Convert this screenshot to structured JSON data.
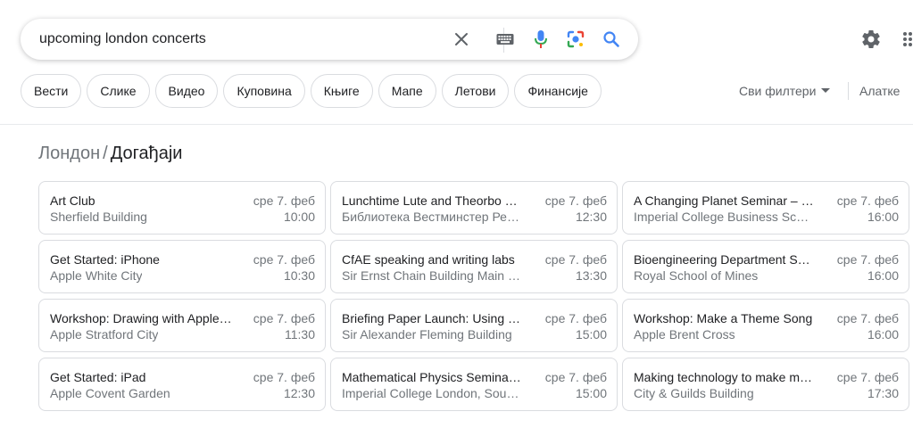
{
  "search": {
    "query": "upcoming london concerts"
  },
  "icons": {
    "clear": "close-icon",
    "keyboard": "keyboard-icon",
    "voice": "microphone-icon",
    "lens": "camera-lens-icon",
    "search": "search-icon",
    "settings": "gear-icon",
    "apps": "apps-grid-icon",
    "filters_dropdown": "caret-down-icon"
  },
  "colors": {
    "mic_blue": "#4285f4",
    "mic_red": "#ea4335",
    "search_blue": "#4285f4",
    "text": "#202124",
    "secondary_text": "#70757a"
  },
  "chips": [
    {
      "label": "Вести"
    },
    {
      "label": "Слике"
    },
    {
      "label": "Видео"
    },
    {
      "label": "Куповина"
    },
    {
      "label": "Књиге"
    },
    {
      "label": "Мапе"
    },
    {
      "label": "Летови"
    },
    {
      "label": "Финансије"
    }
  ],
  "filters": {
    "all_filters": "Сви филтери",
    "tools": "Алатке"
  },
  "breadcrumb": {
    "parent": "Лондон",
    "separator": "/",
    "current": "Догађаји"
  },
  "events": [
    {
      "title": "Art Club",
      "place": "Sherfield Building",
      "date": "сре 7. феб",
      "time": "10:00"
    },
    {
      "title": "Lunchtime Lute and Theorbo …",
      "place": "Библиотека Вестминстер Ре…",
      "date": "сре 7. феб",
      "time": "12:30"
    },
    {
      "title": "A Changing Planet Seminar – …",
      "place": "Imperial College Business Sch…",
      "date": "сре 7. феб",
      "time": "16:00"
    },
    {
      "title": "Get Started: iPhone",
      "place": "Apple White City",
      "date": "сре 7. феб",
      "time": "10:30"
    },
    {
      "title": "CfAE speaking and writing labs",
      "place": "Sir Ernst Chain Building Main …",
      "date": "сре 7. феб",
      "time": "13:30"
    },
    {
      "title": "Bioengineering Department S…",
      "place": "Royal School of Mines",
      "date": "сре 7. феб",
      "time": "16:00"
    },
    {
      "title": "Workshop: Drawing with Apple…",
      "place": "Apple Stratford City",
      "date": "сре 7. феб",
      "time": "11:30"
    },
    {
      "title": "Briefing Paper Launch: Using …",
      "place": "Sir Alexander Fleming Building",
      "date": "сре 7. феб",
      "time": "15:00"
    },
    {
      "title": "Workshop: Make a Theme Song",
      "place": "Apple Brent Cross",
      "date": "сре 7. феб",
      "time": "16:00"
    },
    {
      "title": "Get Started: iPad",
      "place": "Apple Covent Garden",
      "date": "сре 7. феб",
      "time": "12:30"
    },
    {
      "title": "Mathematical Physics Semina…",
      "place": "Imperial College London, Sout…",
      "date": "сре 7. феб",
      "time": "15:00"
    },
    {
      "title": "Making technology to make m…",
      "place": "City & Guilds Building",
      "date": "сре 7. феб",
      "time": "17:30"
    }
  ]
}
